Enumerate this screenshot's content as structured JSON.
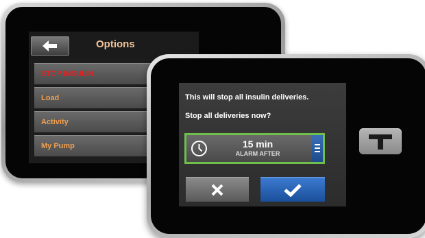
{
  "back_device": {
    "header": {
      "back_icon": "arrow-left-icon",
      "title": "Options"
    },
    "menu": [
      {
        "label": "STOP INSULIN",
        "color": "#e02020"
      },
      {
        "label": "Load",
        "color": "#f0a050"
      },
      {
        "label": "Activity",
        "color": "#f0a050"
      },
      {
        "label": "My Pump",
        "color": "#f0a050"
      }
    ]
  },
  "front_device": {
    "message_line1": "This will stop all insulin deliveries.",
    "message_line2": "Stop all deliveries now?",
    "alarm": {
      "icon": "clock-icon",
      "value": "15 min",
      "label": "ALARM AFTER",
      "list_icon": "list-icon",
      "border_color": "#6fbf4a"
    },
    "cancel_icon": "x-icon",
    "confirm_icon": "checkmark-icon",
    "brand_icon": "t-logo-icon"
  }
}
